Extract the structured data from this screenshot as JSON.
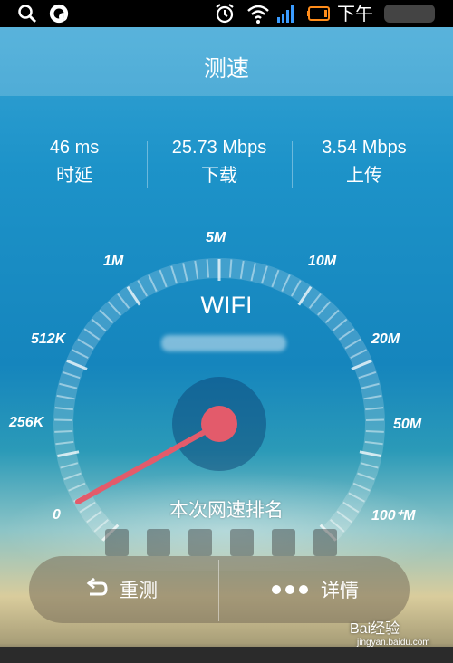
{
  "status_bar": {
    "time": "下午",
    "icons": [
      "search-icon",
      "app-notification-icon",
      "alarm-icon",
      "wifi-icon",
      "signal-icon",
      "battery-icon"
    ]
  },
  "title": "测速",
  "stats": [
    {
      "value": "46 ms",
      "label": "时延"
    },
    {
      "value": "25.73 Mbps",
      "label": "下载"
    },
    {
      "value": "3.54 Mbps",
      "label": "上传"
    }
  ],
  "gauge": {
    "labels": [
      "0",
      "256K",
      "512K",
      "1M",
      "5M",
      "10M",
      "20M",
      "50M",
      "100⁺M"
    ],
    "network": "WIFI",
    "needle_label": "0"
  },
  "rank": {
    "title": "本次网速排名"
  },
  "buttons": {
    "retest": "重测",
    "details": "详情"
  },
  "watermark": {
    "brand": "Bai经验",
    "url": "jingyan.baidu.com"
  },
  "colors": {
    "accent": "#e35b6b",
    "bg": "#1a8ec6"
  }
}
